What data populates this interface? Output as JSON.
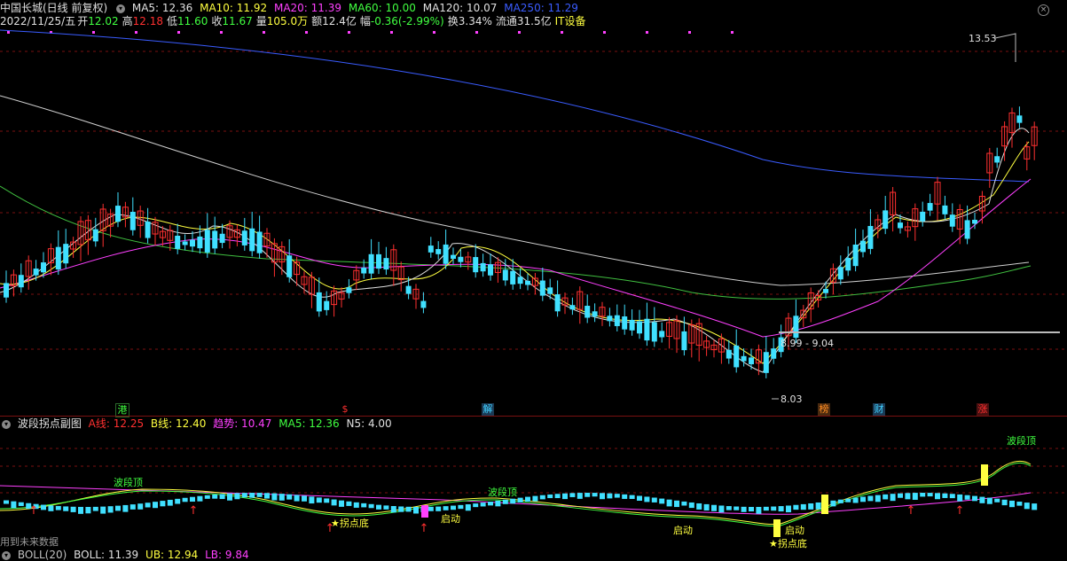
{
  "header": {
    "title": "中国长城(日线 前复权)",
    "ma_items": [
      {
        "label": "MA5: 12.36",
        "color": "#e0e0e0"
      },
      {
        "label": "MA10: 11.92",
        "color": "#ffff40"
      },
      {
        "label": "MA20: 11.39",
        "color": "#ff40ff"
      },
      {
        "label": "MA60: 10.00",
        "color": "#40ff40"
      },
      {
        "label": "MA120: 10.07",
        "color": "#e0e0e0"
      },
      {
        "label": "MA250: 11.29",
        "color": "#3a5cff"
      }
    ],
    "date": "2022/11/25/五",
    "quote": [
      {
        "label": "开",
        "value": "12.02",
        "color": "#40ff40"
      },
      {
        "label": "高",
        "value": "12.18",
        "color": "#ff3030"
      },
      {
        "label": "低",
        "value": "11.60",
        "color": "#40ff40"
      },
      {
        "label": "收",
        "value": "11.67",
        "color": "#40ff40"
      },
      {
        "label": "量",
        "value": "105.0万",
        "color": "#ffff40"
      },
      {
        "label": "额",
        "value": "12.4亿",
        "color": "#e0e0e0"
      },
      {
        "label": "幅",
        "value": "-0.36(-2.99%)",
        "color": "#40ff40"
      },
      {
        "label": "换",
        "value": "3.34%",
        "color": "#e0e0e0"
      },
      {
        "label": "流通",
        "value": "31.5亿",
        "color": "#e0e0e0"
      },
      {
        "label": "IT设备",
        "value": "",
        "color": "#ffff40"
      }
    ],
    "close_icon": "close-icon"
  },
  "main_chart": {
    "high_label": "13.53",
    "low_label": "8.03",
    "range_label": "8.99 - 9.04",
    "events": [
      {
        "text": "港",
        "color": "#40ff40"
      },
      {
        "text": "$",
        "color": "#ff3030"
      },
      {
        "text": "解",
        "color": "#40d0ff"
      },
      {
        "text": "榜",
        "color": "#ff8c20"
      },
      {
        "text": "财",
        "color": "#40d0ff"
      },
      {
        "text": "涨",
        "color": "#ff3030"
      }
    ]
  },
  "sub_panel": {
    "title": "波段拐点副图",
    "values": [
      {
        "label": "A线: 12.25",
        "color": "#ff3030"
      },
      {
        "label": "B线: 12.40",
        "color": "#ffff40"
      },
      {
        "label": "趋势: 10.47",
        "color": "#ff40ff"
      },
      {
        "label": "MA5: 12.36",
        "color": "#40ff40"
      },
      {
        "label": "N5: 4.00",
        "color": "#e0e0e0"
      }
    ],
    "annotations": {
      "top": "波段顶",
      "bottom": "拐点底",
      "start": "启动"
    },
    "future_data": "用到未来数据"
  },
  "footer": {
    "items": [
      {
        "label": "BOLL(20)",
        "color": "#c0c0c0"
      },
      {
        "label": "BOLL: 11.39",
        "color": "#e0e0e0"
      },
      {
        "label": "UB: 12.94",
        "color": "#ffff40"
      },
      {
        "label": "LB: 9.84",
        "color": "#ff40ff"
      }
    ]
  }
}
